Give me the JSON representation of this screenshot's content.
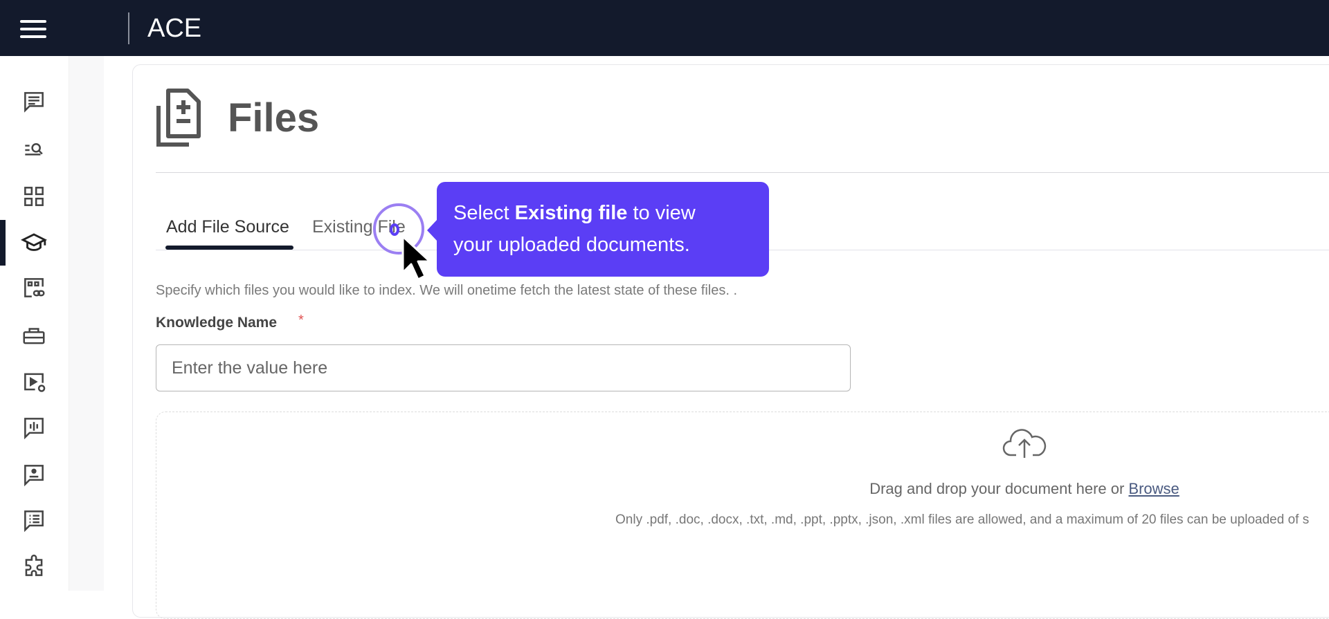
{
  "header": {
    "title": "ACE",
    "menu_icon": "hamburger-icon"
  },
  "sidebar": {
    "items": [
      {
        "icon": "chat-icon"
      },
      {
        "icon": "search-list-icon"
      },
      {
        "icon": "grid-icon"
      },
      {
        "icon": "graduation-cap-icon",
        "active": true
      },
      {
        "icon": "link-card-icon"
      },
      {
        "icon": "toolbox-icon"
      },
      {
        "icon": "video-settings-icon"
      },
      {
        "icon": "audio-chat-icon"
      },
      {
        "icon": "person-chat-icon"
      },
      {
        "icon": "list-chat-icon"
      },
      {
        "icon": "puzzle-icon"
      }
    ]
  },
  "page": {
    "title": "Files",
    "tabs": [
      {
        "label": "Add File Source",
        "active": true
      },
      {
        "label": "Existing File",
        "active": false
      }
    ],
    "description": "Specify which files you would like to index. We will onetime fetch the latest state of these files. .",
    "knowledge_label": "Knowledge Name",
    "required_mark": "*",
    "knowledge_placeholder": "Enter the value here",
    "knowledge_value": "",
    "drop": {
      "text": "Drag and drop your document here or ",
      "browse": "Browse",
      "hint": "Only .pdf, .doc, .docx, .txt, .md, .ppt, .pptx, .json, .xml files are allowed, and a maximum of 20 files can be uploaded of s"
    }
  },
  "tooltip": {
    "pre": "Select ",
    "bold": "Existing file",
    "post": " to view",
    "line2": "your uploaded documents.",
    "color": "#5b3ef5"
  }
}
